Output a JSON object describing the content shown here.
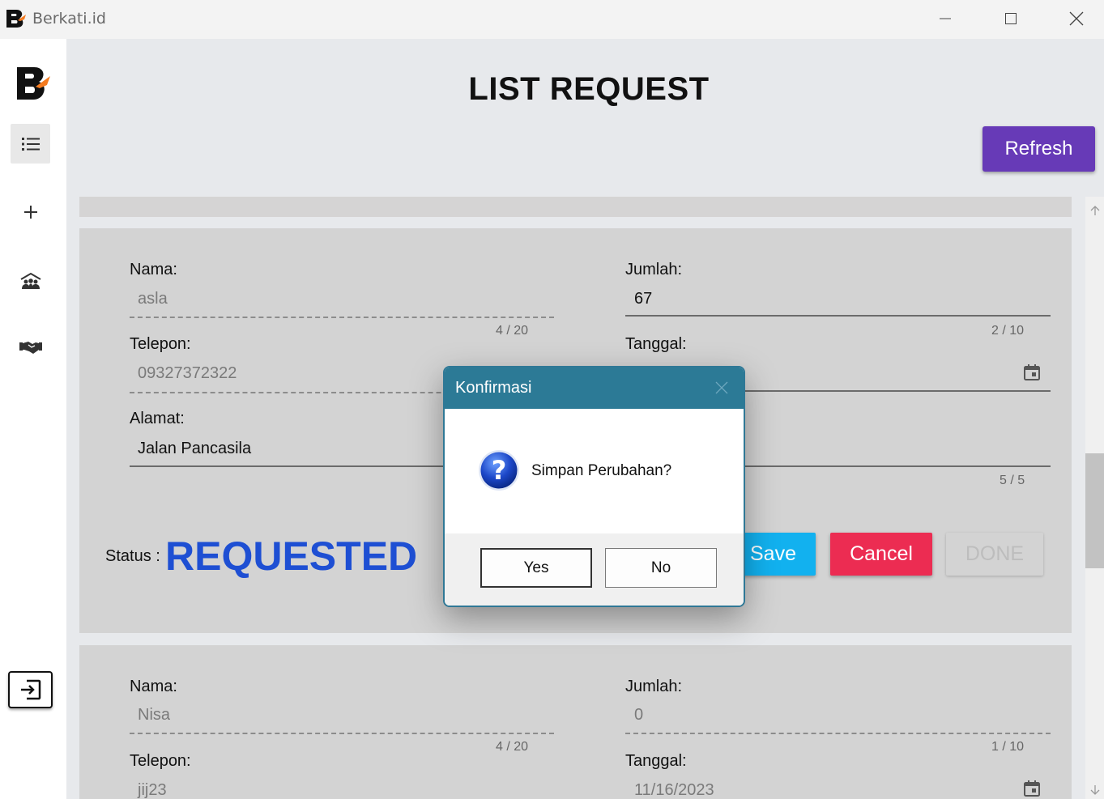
{
  "window": {
    "title": "Berkati.id"
  },
  "sidebar": {
    "items": [
      {
        "icon": "list-icon"
      },
      {
        "icon": "plus-icon"
      },
      {
        "icon": "community-icon"
      },
      {
        "icon": "handshake-icon"
      }
    ],
    "exit_icon": "exit-icon"
  },
  "page": {
    "title": "LIST REQUEST",
    "refresh_label": "Refresh"
  },
  "requests": [
    {
      "nama_label": "Nama:",
      "nama": "asla",
      "nama_counter": "4 / 20",
      "jumlah_label": "Jumlah:",
      "jumlah": "67",
      "jumlah_counter": "2 / 10",
      "telepon_label": "Telepon:",
      "telepon": "09327372322",
      "tanggal_label": "Tanggal:",
      "alamat_label": "Alamat:",
      "alamat": "Jalan Pancasila",
      "extra_counter": "5 / 5",
      "status_label": "Status :",
      "status": "REQUESTED",
      "save_label": "Save",
      "cancel_label": "Cancel",
      "done_label": "DONE"
    },
    {
      "nama_label": "Nama:",
      "nama": "Nisa",
      "nama_counter": "4 / 20",
      "jumlah_label": "Jumlah:",
      "jumlah": "0",
      "jumlah_counter": "1 / 10",
      "telepon_label": "Telepon:",
      "telepon": "jij23",
      "tanggal_label": "Tanggal:",
      "tanggal": "11/16/2023"
    }
  ],
  "dialog": {
    "title": "Konfirmasi",
    "message": "Simpan Perubahan?",
    "yes_label": "Yes",
    "no_label": "No"
  },
  "colors": {
    "accent": "#673ab7",
    "status": "#1e4fd3",
    "save": "#12b1ef",
    "cancel": "#ec2c52",
    "dialog_header": "#2c7a96"
  }
}
